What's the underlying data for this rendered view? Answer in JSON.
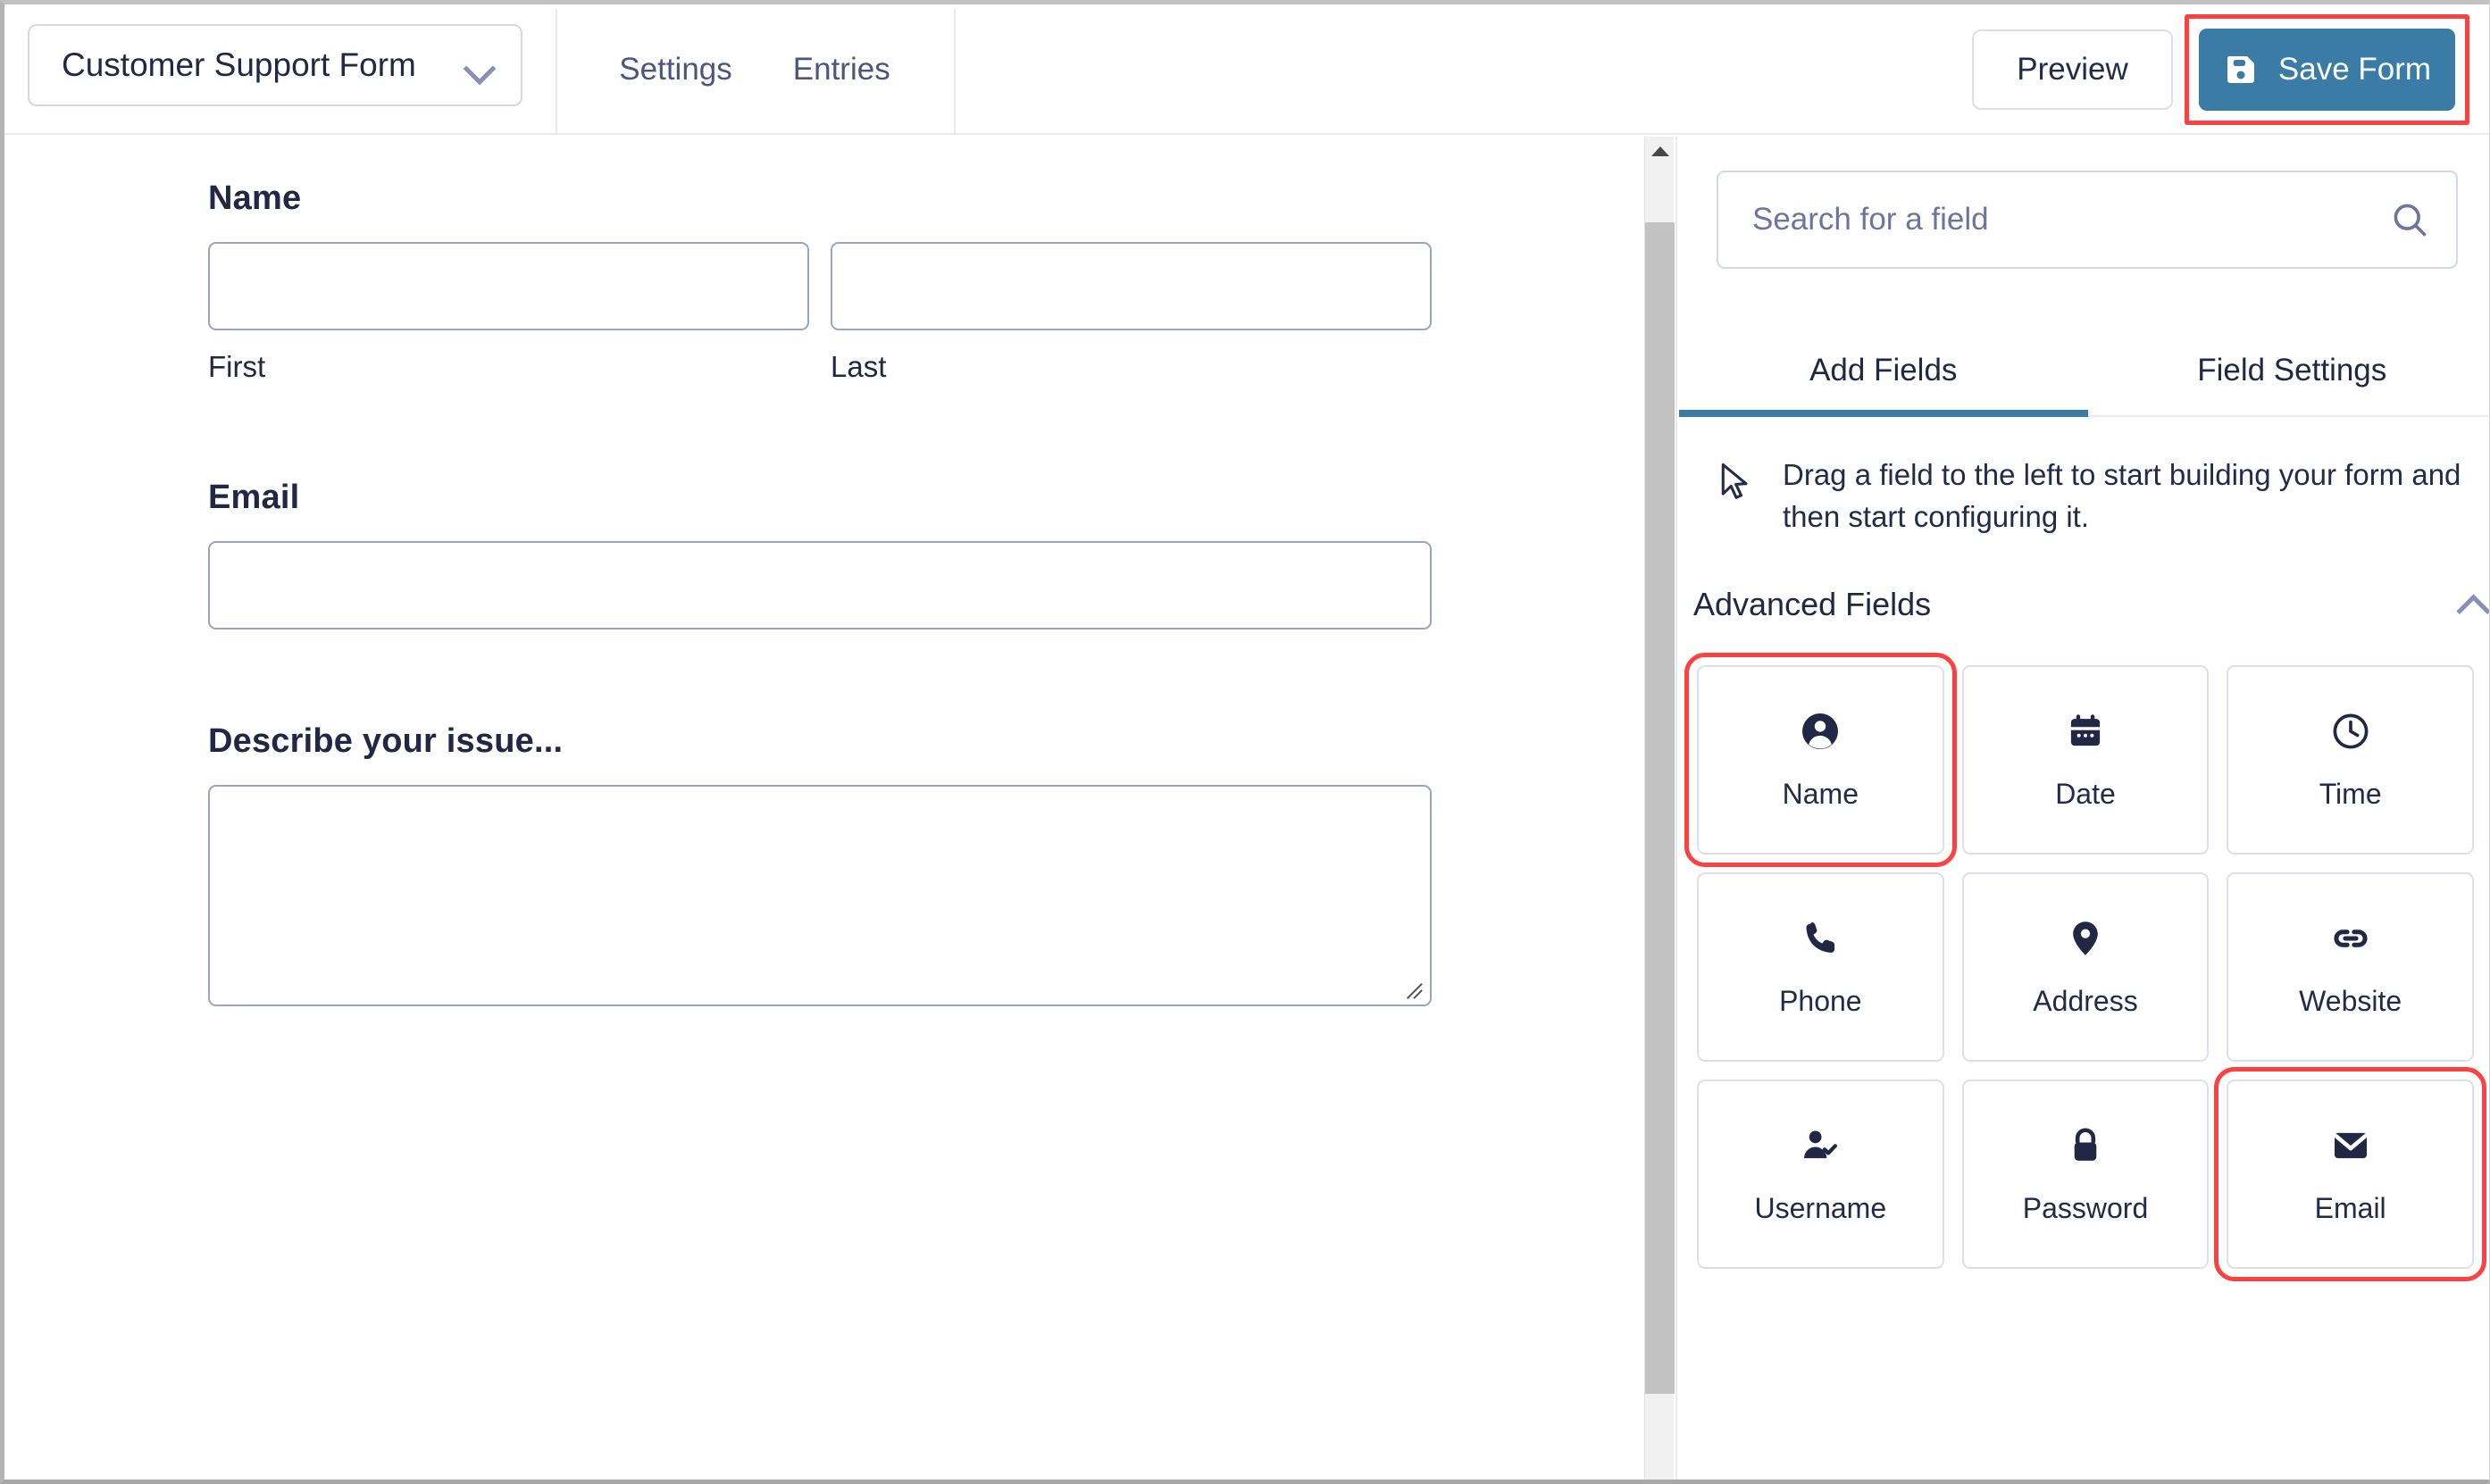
{
  "header": {
    "form_select_label": "Customer Support Form",
    "form_select_icon": "chevron-down-icon",
    "tabs": [
      {
        "label": "Settings"
      },
      {
        "label": "Entries"
      }
    ],
    "preview_label": "Preview",
    "save_label": "Save Form",
    "save_icon": "save-disk-icon",
    "save_button_color": "#3a7ca5",
    "highlight_color": "#fc4141"
  },
  "form": {
    "fields": [
      {
        "label": "Name",
        "type": "name",
        "subfields": [
          {
            "sub_label": "First",
            "value": "",
            "placeholder": ""
          },
          {
            "sub_label": "Last",
            "value": "",
            "placeholder": ""
          }
        ]
      },
      {
        "label": "Email",
        "type": "email",
        "value": "",
        "placeholder": ""
      },
      {
        "label": "Describe your issue...",
        "type": "textarea",
        "value": "",
        "placeholder": ""
      }
    ]
  },
  "scrollbar": {
    "up_arrow_icon": "caret-up-icon",
    "orientation": "vertical"
  },
  "panel": {
    "search": {
      "value": "",
      "placeholder": "Search for a field",
      "icon": "search-icon"
    },
    "tabs": [
      {
        "label": "Add Fields",
        "active": true
      },
      {
        "label": "Field Settings",
        "active": false
      }
    ],
    "active_tab_color": "#3a7ca5",
    "hint": {
      "icon": "cursor-arrow-icon",
      "text": "Drag a field to the left to start building your form and then start configuring it."
    },
    "section": {
      "title": "Advanced Fields",
      "collapse_icon": "chevron-up-icon",
      "expanded": true
    },
    "field_cards": [
      {
        "label": "Name",
        "icon": "user-circle-icon",
        "highlighted": true
      },
      {
        "label": "Date",
        "icon": "calendar-icon",
        "highlighted": false
      },
      {
        "label": "Time",
        "icon": "clock-icon",
        "highlighted": false
      },
      {
        "label": "Phone",
        "icon": "phone-icon",
        "highlighted": false
      },
      {
        "label": "Address",
        "icon": "map-pin-icon",
        "highlighted": false
      },
      {
        "label": "Website",
        "icon": "link-icon",
        "highlighted": false
      },
      {
        "label": "Username",
        "icon": "user-check-icon",
        "highlighted": false
      },
      {
        "label": "Password",
        "icon": "lock-icon",
        "highlighted": false
      },
      {
        "label": "Email",
        "icon": "envelope-icon",
        "highlighted": true
      }
    ]
  }
}
